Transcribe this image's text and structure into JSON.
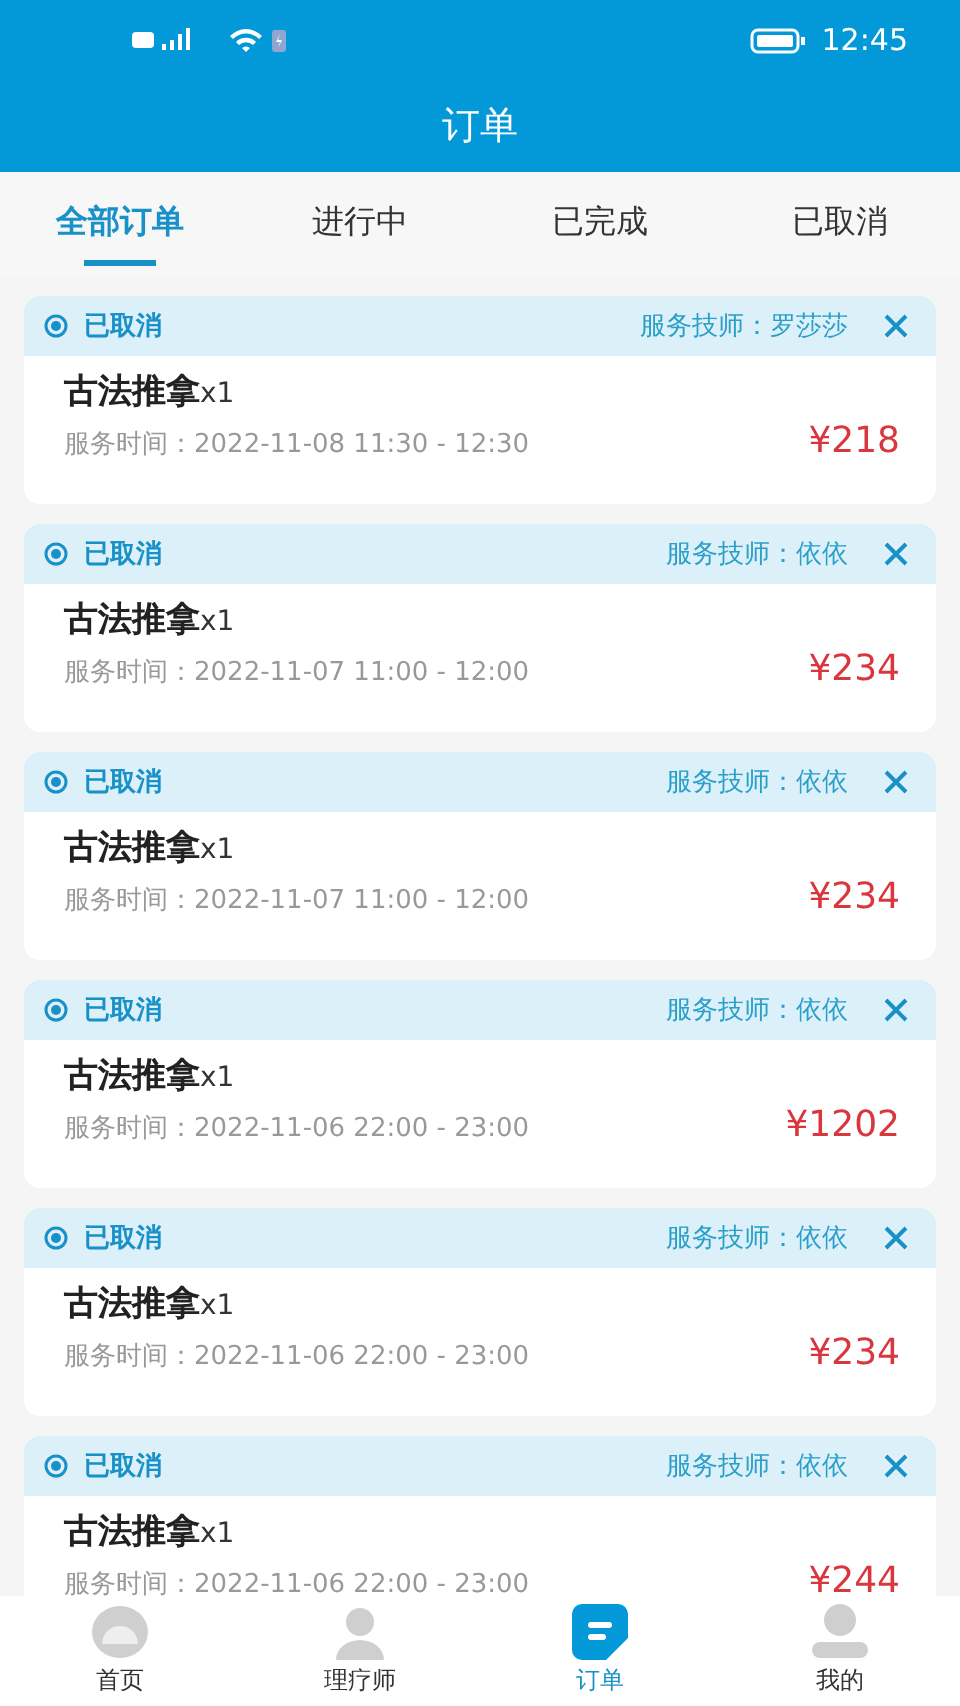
{
  "status_bar": {
    "time": "12:45"
  },
  "title": "订单",
  "tabs": [
    {
      "label": "全部订单",
      "selected": true
    },
    {
      "label": "进行中",
      "selected": false
    },
    {
      "label": "已完成",
      "selected": false
    },
    {
      "label": "已取消",
      "selected": false
    }
  ],
  "orders": [
    {
      "status": "已取消",
      "technician": "服务技师：罗莎莎",
      "service": "古法推拿",
      "quantity": "x1",
      "time": "服务时间：2022-11-08 11:30 - 12:30",
      "price": "¥218"
    },
    {
      "status": "已取消",
      "technician": "服务技师：依依",
      "service": "古法推拿",
      "quantity": "x1",
      "time": "服务时间：2022-11-07 11:00 - 12:00",
      "price": "¥234"
    },
    {
      "status": "已取消",
      "technician": "服务技师：依依",
      "service": "古法推拿",
      "quantity": "x1",
      "time": "服务时间：2022-11-07 11:00 - 12:00",
      "price": "¥234"
    },
    {
      "status": "已取消",
      "technician": "服务技师：依依",
      "service": "古法推拿",
      "quantity": "x1",
      "time": "服务时间：2022-11-06 22:00 - 23:00",
      "price": "¥1202"
    },
    {
      "status": "已取消",
      "technician": "服务技师：依依",
      "service": "古法推拿",
      "quantity": "x1",
      "time": "服务时间：2022-11-06 22:00 - 23:00",
      "price": "¥234"
    },
    {
      "status": "已取消",
      "technician": "服务技师：依依",
      "service": "古法推拿",
      "quantity": "x1",
      "time": "服务时间：2022-11-06 22:00 - 23:00",
      "price": "¥244"
    }
  ],
  "nav": [
    {
      "kind": "home",
      "label": "首页",
      "selected": false
    },
    {
      "kind": "therapist",
      "label": "理疗师",
      "selected": false
    },
    {
      "kind": "orders",
      "label": "订单",
      "selected": true
    },
    {
      "kind": "profile",
      "label": "我的",
      "selected": false
    }
  ]
}
